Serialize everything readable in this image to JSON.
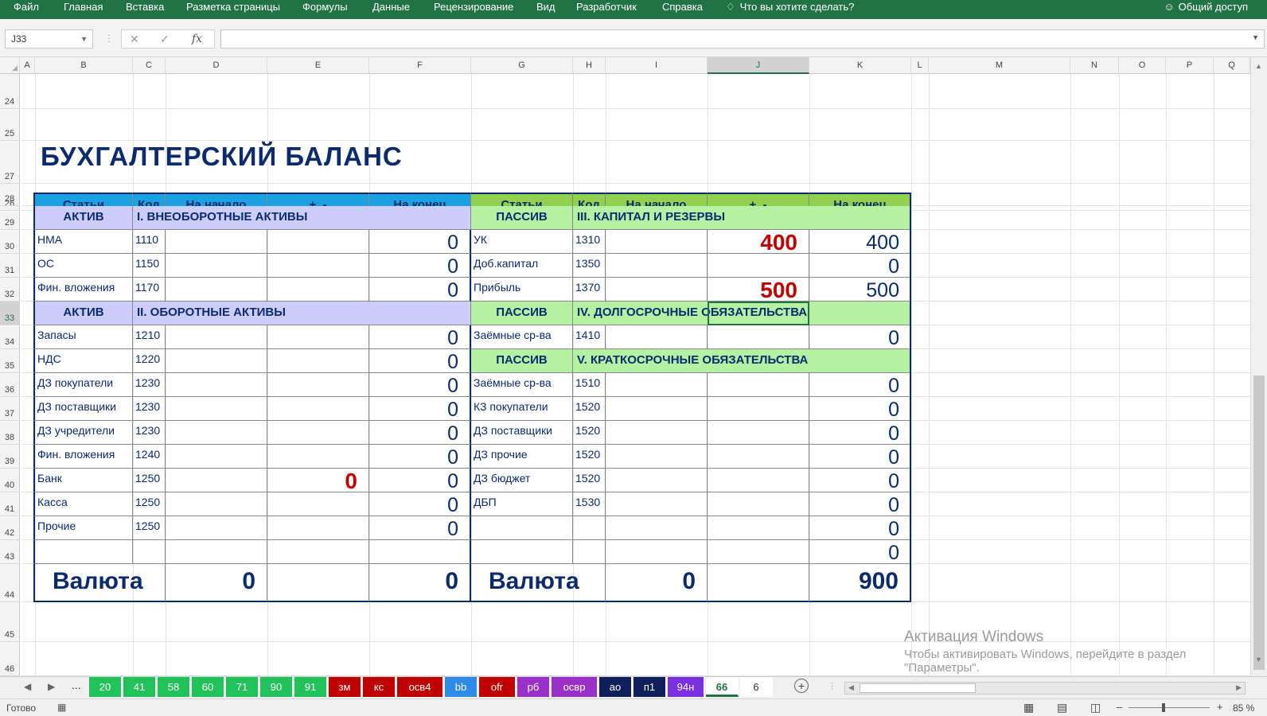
{
  "ribbon": {
    "menu": [
      "Файл",
      "Главная",
      "Вставка",
      "Разметка страницы",
      "Формулы",
      "Данные",
      "Рецензирование",
      "Вид",
      "Разработчик",
      "Справка"
    ],
    "tell_me": "Что вы хотите сделать?",
    "share": "Общий доступ"
  },
  "formula_bar": {
    "name_box": "J33",
    "formula": ""
  },
  "columns": [
    "A",
    "B",
    "C",
    "D",
    "E",
    "F",
    "G",
    "H",
    "I",
    "J",
    "K",
    "L",
    "M",
    "N",
    "O",
    "P",
    "Q"
  ],
  "selected_column": "J",
  "rows": [
    "24",
    "25",
    "26",
    "27",
    "28",
    "29",
    "30",
    "31",
    "32",
    "33",
    "34",
    "35",
    "36",
    "37",
    "38",
    "39",
    "40",
    "41",
    "42",
    "43",
    "44",
    "45",
    "46"
  ],
  "selected_row": "33",
  "sheet": {
    "title": "БУХГАЛТЕРСКИЙ БАЛАНС",
    "headers": [
      "Статьи",
      "Код",
      "На начало",
      "+, -",
      "На конец"
    ],
    "left": {
      "sections": [
        {
          "part": "АКТИВ",
          "name": "I. ВНЕОБОРОТНЫЕ АКТИВЫ"
        },
        {
          "part": "АКТИВ",
          "name": "II. ОБОРОТНЫЕ АКТИВЫ"
        }
      ],
      "rows": [
        {
          "label": "НМА",
          "code": "1110",
          "start": "",
          "delta": "",
          "end": "0"
        },
        {
          "label": "ОС",
          "code": "1150",
          "start": "",
          "delta": "",
          "end": "0"
        },
        {
          "label": "Фин. вложения",
          "code": "1170",
          "start": "",
          "delta": "",
          "end": "0"
        },
        {
          "label": "Запасы",
          "code": "1210",
          "start": "",
          "delta": "",
          "end": "0"
        },
        {
          "label": "НДС",
          "code": "1220",
          "start": "",
          "delta": "",
          "end": "0"
        },
        {
          "label": "ДЗ покупатели",
          "code": "1230",
          "start": "",
          "delta": "",
          "end": "0"
        },
        {
          "label": "ДЗ поставщики",
          "code": "1230",
          "start": "",
          "delta": "",
          "end": "0"
        },
        {
          "label": "ДЗ учредители",
          "code": "1230",
          "start": "",
          "delta": "",
          "end": "0"
        },
        {
          "label": "Фин. вложения",
          "code": "1240",
          "start": "",
          "delta": "",
          "end": "0"
        },
        {
          "label": "Банк",
          "code": "1250",
          "start": "",
          "delta": "0",
          "end": "0"
        },
        {
          "label": "Касса",
          "code": "1250",
          "start": "",
          "delta": "",
          "end": "0"
        },
        {
          "label": "Прочие",
          "code": "1250",
          "start": "",
          "delta": "",
          "end": "0"
        },
        {
          "label": "",
          "code": "",
          "start": "",
          "delta": "",
          "end": ""
        }
      ],
      "total": {
        "label": "Валюта",
        "start": "0",
        "end": "0"
      }
    },
    "right": {
      "sections": [
        {
          "part": "ПАССИВ",
          "name": "III. КАПИТАЛ И РЕЗЕРВЫ"
        },
        {
          "part": "ПАССИВ",
          "name": "IV. ДОЛГОСРОЧНЫЕ ОБЯЗАТЕЛЬСТВА"
        },
        {
          "part": "ПАССИВ",
          "name": "V. КРАТКОСРОЧНЫЕ ОБЯЗАТЕЛЬСТВА"
        }
      ],
      "rows": [
        {
          "label": "УК",
          "code": "1310",
          "start": "",
          "delta": "400",
          "end": "400"
        },
        {
          "label": "Доб.капитал",
          "code": "1350",
          "start": "",
          "delta": "",
          "end": "0"
        },
        {
          "label": "Прибыль",
          "code": "1370",
          "start": "",
          "delta": "500",
          "end": "500"
        },
        {
          "label": "Заёмные ср-ва",
          "code": "1410",
          "start": "",
          "delta": "",
          "end": "0"
        },
        {
          "label": "Заёмные ср-ва",
          "code": "1510",
          "start": "",
          "delta": "",
          "end": "0"
        },
        {
          "label": "КЗ покупатели",
          "code": "1520",
          "start": "",
          "delta": "",
          "end": "0"
        },
        {
          "label": "ДЗ поставщики",
          "code": "1520",
          "start": "",
          "delta": "",
          "end": "0"
        },
        {
          "label": "ДЗ прочие",
          "code": "1520",
          "start": "",
          "delta": "",
          "end": "0"
        },
        {
          "label": "ДЗ бюджет",
          "code": "1520",
          "start": "",
          "delta": "",
          "end": "0"
        },
        {
          "label": "ДБП",
          "code": "1530",
          "start": "",
          "delta": "",
          "end": "0"
        },
        {
          "label": "",
          "code": "",
          "start": "",
          "delta": "",
          "end": "0"
        },
        {
          "label": "",
          "code": "",
          "start": "",
          "delta": "",
          "end": "0"
        }
      ],
      "total": {
        "label": "Валюта",
        "start": "0",
        "end": "900"
      }
    }
  },
  "tabs": [
    {
      "name": "20",
      "color": "#22c25a"
    },
    {
      "name": "41",
      "color": "#22c25a"
    },
    {
      "name": "58",
      "color": "#22c25a"
    },
    {
      "name": "60",
      "color": "#22c25a"
    },
    {
      "name": "71",
      "color": "#22c25a"
    },
    {
      "name": "90",
      "color": "#22c25a"
    },
    {
      "name": "91",
      "color": "#22c25a"
    },
    {
      "name": "зм",
      "color": "#c00000"
    },
    {
      "name": "кс",
      "color": "#c00000"
    },
    {
      "name": "осв4",
      "color": "#c00000"
    },
    {
      "name": "bb",
      "color": "#2e8be6"
    },
    {
      "name": "ofr",
      "color": "#c00000"
    },
    {
      "name": "рб",
      "color": "#9b30c8"
    },
    {
      "name": "освр",
      "color": "#9b30c8"
    },
    {
      "name": "ао",
      "color": "#0f1f5c"
    },
    {
      "name": "п1",
      "color": "#0f1f5c"
    },
    {
      "name": "94н",
      "color": "#7a2fe0"
    },
    {
      "name": "66",
      "color": "#ffffff"
    },
    {
      "name": "6",
      "color": "#ffffff"
    }
  ],
  "active_tab": "66",
  "tabs_more": "...",
  "status": {
    "ready": "Готово",
    "zoom": "85 %"
  },
  "watermark": {
    "line1": "Активация Windows",
    "line2": "Чтобы активировать Windows, перейдите в раздел",
    "line3": "\"Параметры\"."
  }
}
